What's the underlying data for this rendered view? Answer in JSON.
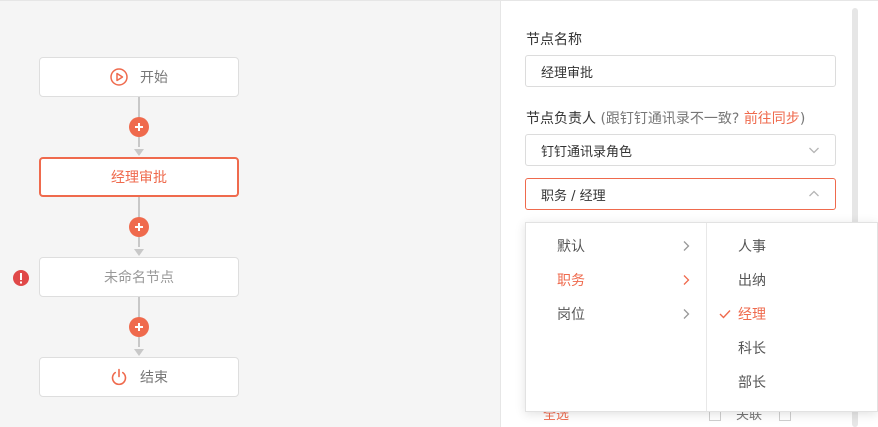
{
  "flow": {
    "nodes": [
      {
        "label": "开始",
        "icon": "play-circle-icon"
      },
      {
        "label": "经理审批"
      },
      {
        "label": "未命名节点"
      },
      {
        "label": "结束",
        "icon": "power-icon"
      }
    ]
  },
  "panel": {
    "name_label": "节点名称",
    "name_value": "经理审批",
    "owner_label": "节点负责人",
    "owner_hint": "(跟钉钉通讯录不一致?",
    "owner_link": "前往同步",
    "owner_hint_end": ")",
    "source_value": "钉钉通讯录角色",
    "role_value": "职务 / 经理",
    "peek_text": "全选",
    "peek_text2": "关联"
  },
  "cascader": {
    "level1": [
      "默认",
      "职务",
      "岗位"
    ],
    "level1_selected": "职务",
    "level2": [
      "人事",
      "出纳",
      "经理",
      "科长",
      "部长"
    ],
    "level2_selected": "经理"
  },
  "colors": {
    "accent": "#ef6a4d",
    "warning": "#e04848"
  }
}
